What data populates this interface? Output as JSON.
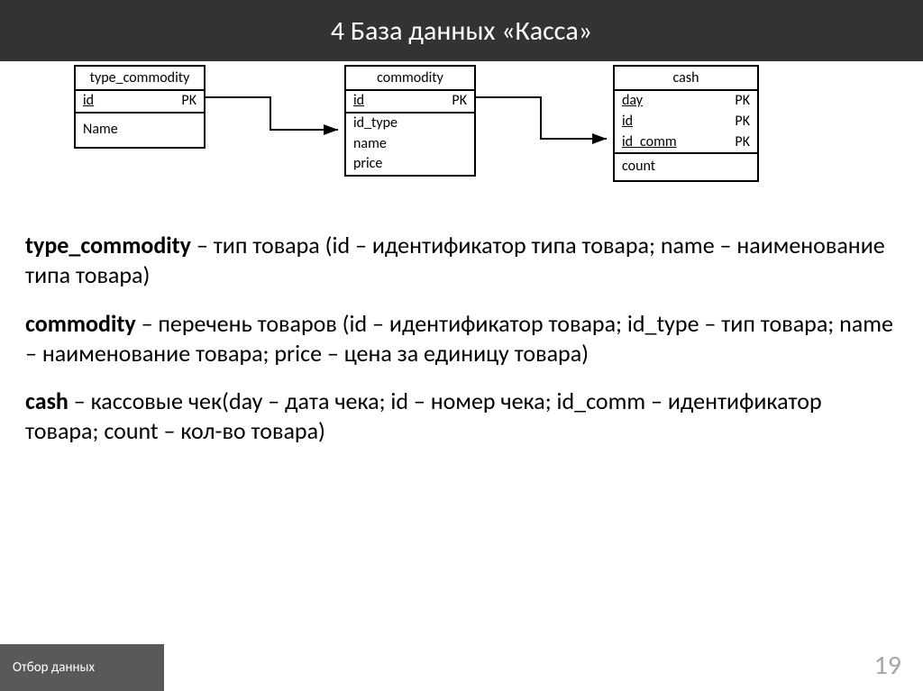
{
  "header": {
    "title": "4  База данных «Касса»"
  },
  "entities": {
    "type_commodity": {
      "name": "type_commodity",
      "keys": [
        {
          "field": "id",
          "tag": "PK",
          "underline": true
        }
      ],
      "attrs": [
        {
          "field": "Name"
        }
      ]
    },
    "commodity": {
      "name": "commodity",
      "keys": [
        {
          "field": "id",
          "tag": "PK",
          "underline": true
        }
      ],
      "attrs": [
        {
          "field": "id_type"
        },
        {
          "field": "name"
        },
        {
          "field": "price"
        }
      ]
    },
    "cash": {
      "name": "cash",
      "keys": [
        {
          "field": "day",
          "tag": "PK",
          "underline": true
        },
        {
          "field": "id",
          "tag": "PK",
          "underline": true
        },
        {
          "field": "id_comm",
          "tag": "PK",
          "underline": true
        }
      ],
      "attrs": [
        {
          "field": "count"
        }
      ]
    }
  },
  "descriptions": {
    "p1": {
      "bold": "type_commodity",
      "rest": " – тип товара (id – идентификатор типа товара; name – наименование типа товара)"
    },
    "p2": {
      "bold": "commodity",
      "rest": " – перечень товаров (id – идентификатор товара; id_type – тип товара; name – наименование товара; price – цена за единицу товара)"
    },
    "p3": {
      "bold": "cash",
      "rest": " – кассовые чек(day – дата чека; id – номер чека; id_comm – идентификатор товара; count – кол-во товара)"
    }
  },
  "footer": {
    "label": "Отбор данных",
    "page": "19"
  }
}
